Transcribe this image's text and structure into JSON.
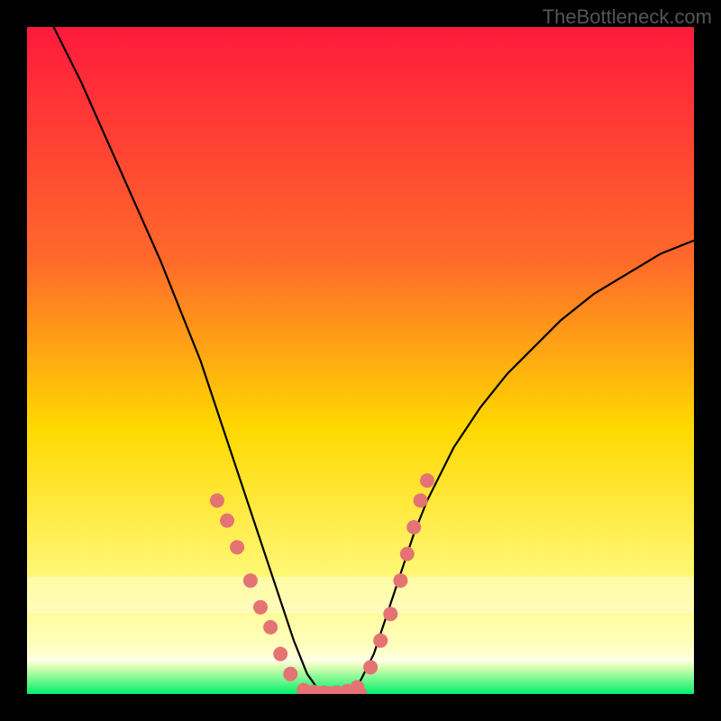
{
  "watermark": "TheBottleneck.com",
  "chart_data": {
    "type": "line",
    "title": "",
    "xlabel": "",
    "ylabel": "",
    "xlim": [
      0,
      100
    ],
    "ylim": [
      0,
      100
    ],
    "background_gradient": {
      "top": "#ff1a3c",
      "mid1": "#ffd800",
      "mid2": "#fff97a",
      "bottom_band": "#00f06a"
    },
    "curve": {
      "description": "V-shaped bottleneck curve; y ≈ 100 denotes severe bottleneck (red), y ≈ 0 denotes balanced (green). Minimum near x ≈ 44.",
      "x": [
        4,
        8,
        12,
        16,
        20,
        24,
        26,
        28,
        30,
        32,
        34,
        36,
        38,
        40,
        42,
        44,
        46,
        48,
        50,
        52,
        54,
        56,
        58,
        60,
        64,
        68,
        72,
        76,
        80,
        85,
        90,
        95,
        100
      ],
      "y": [
        100,
        92,
        83,
        74,
        65,
        55,
        50,
        44,
        38,
        32,
        26,
        20,
        14,
        8,
        3,
        0.2,
        0.2,
        0.5,
        2,
        6,
        12,
        18,
        24,
        29,
        37,
        43,
        48,
        52,
        56,
        60,
        63,
        66,
        68
      ]
    },
    "flat_bottom": {
      "x_start": 42,
      "x_end": 50,
      "y": 0.2
    },
    "dots_left": [
      {
        "x": 28.5,
        "y": 29
      },
      {
        "x": 30.0,
        "y": 26
      },
      {
        "x": 31.5,
        "y": 22
      },
      {
        "x": 33.5,
        "y": 17
      },
      {
        "x": 35.0,
        "y": 13
      },
      {
        "x": 36.5,
        "y": 10
      },
      {
        "x": 38.0,
        "y": 6
      },
      {
        "x": 39.5,
        "y": 3
      }
    ],
    "dots_right": [
      {
        "x": 51.5,
        "y": 4
      },
      {
        "x": 53.0,
        "y": 8
      },
      {
        "x": 54.5,
        "y": 12
      },
      {
        "x": 56.0,
        "y": 17
      },
      {
        "x": 57.0,
        "y": 21
      },
      {
        "x": 58.0,
        "y": 25
      },
      {
        "x": 59.0,
        "y": 29
      },
      {
        "x": 60.0,
        "y": 32
      }
    ],
    "dots_bottom": [
      {
        "x": 41.5,
        "y": 0.6
      },
      {
        "x": 43.0,
        "y": 0.3
      },
      {
        "x": 44.5,
        "y": 0.2
      },
      {
        "x": 46.5,
        "y": 0.2
      },
      {
        "x": 48.0,
        "y": 0.4
      },
      {
        "x": 49.5,
        "y": 1.0
      }
    ],
    "dot_style": {
      "fill": "#e57373",
      "r": 8
    }
  }
}
